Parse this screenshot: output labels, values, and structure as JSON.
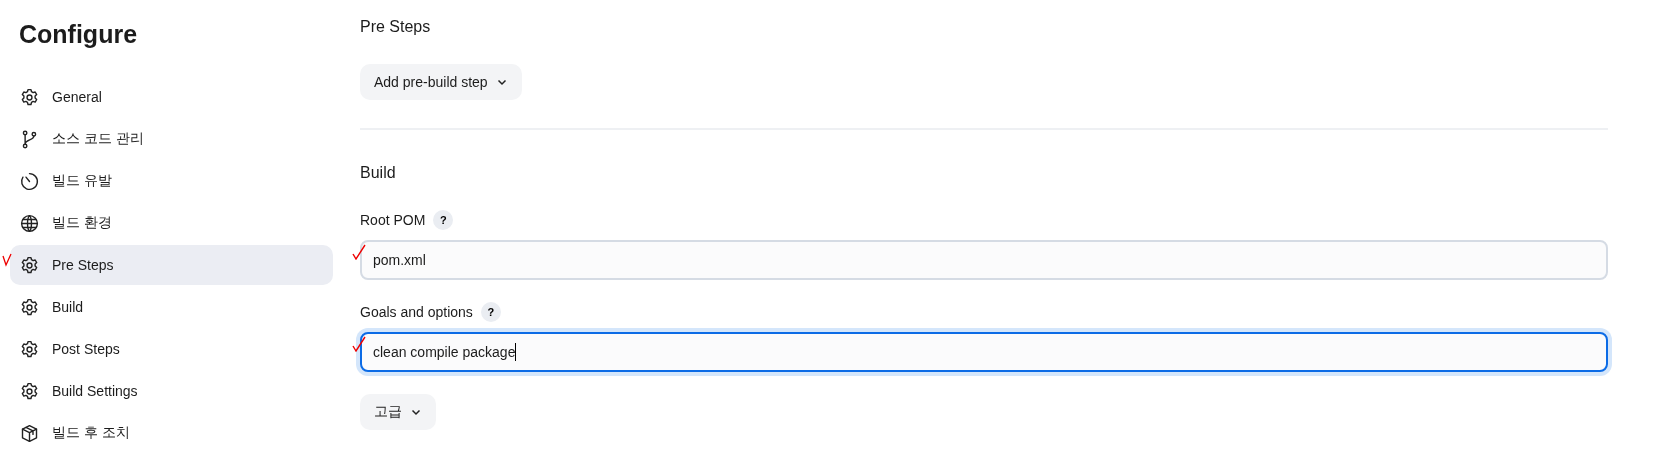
{
  "sidebar": {
    "title": "Configure",
    "items": [
      {
        "label": "General",
        "kind": "gear",
        "selected": false,
        "marked": false
      },
      {
        "label": "소스 코드 관리",
        "kind": "branch",
        "selected": false,
        "marked": false
      },
      {
        "label": "빌드 유발",
        "kind": "timer",
        "selected": false,
        "marked": false
      },
      {
        "label": "빌드 환경",
        "kind": "globe",
        "selected": false,
        "marked": false
      },
      {
        "label": "Pre Steps",
        "kind": "gear",
        "selected": true,
        "marked": true
      },
      {
        "label": "Build",
        "kind": "gear",
        "selected": false,
        "marked": false
      },
      {
        "label": "Post Steps",
        "kind": "gear",
        "selected": false,
        "marked": false
      },
      {
        "label": "Build Settings",
        "kind": "gear",
        "selected": false,
        "marked": false
      },
      {
        "label": "빌드 후 조치",
        "kind": "package",
        "selected": false,
        "marked": false
      }
    ]
  },
  "sections": [
    {
      "title": "Pre Steps",
      "button": "Add pre-build step"
    },
    {
      "title": "Build",
      "fields": [
        {
          "label": "Root POM",
          "help": "?",
          "value": "pom.xml",
          "focused": false,
          "marked": true
        },
        {
          "label": "Goals and options",
          "help": "?",
          "value": "clean compile package",
          "focused": true,
          "marked": true
        }
      ],
      "button": "고급"
    }
  ]
}
